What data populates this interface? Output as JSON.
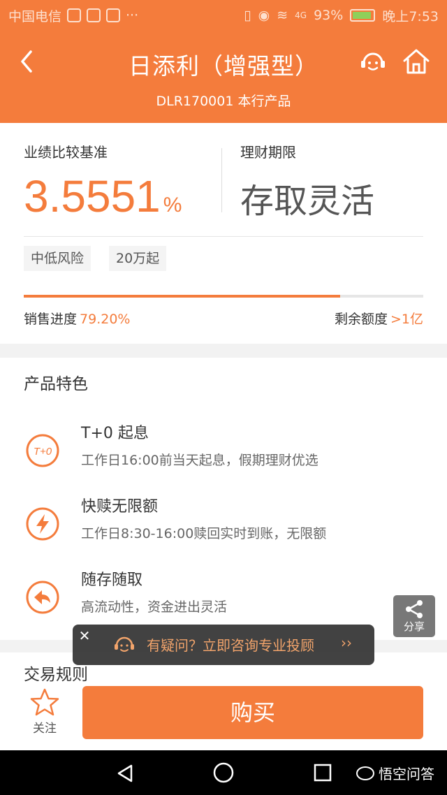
{
  "status_bar": {
    "carrier": "中国电信",
    "battery": "93%",
    "time": "晚上7:53",
    "signal": "4G"
  },
  "header": {
    "title": "日添利（增强型）",
    "subtitle": "DLR170001 本行产品"
  },
  "product": {
    "rate_label": "业绩比较基准",
    "rate_value": "3.5551",
    "rate_unit": "%",
    "term_label": "理财期限",
    "term_value": "存取灵活",
    "tags": [
      "中低风险",
      "20万起"
    ],
    "progress_fraction": 0.792,
    "sales_label": "销售进度",
    "sales_value": "79.20%",
    "remaining_label": "剩余额度",
    "remaining_value": ">1亿"
  },
  "features": {
    "title": "产品特色",
    "items": [
      {
        "icon": "t0-icon",
        "title": "T+0 起息",
        "desc": "工作日16:00前当天起息，假期理财优选"
      },
      {
        "icon": "lightning-icon",
        "title": "快赎无限额",
        "desc": "工作日8:30-16:00赎回实时到账，无限额"
      },
      {
        "icon": "return-arrow-icon",
        "title": "随存随取",
        "desc": "高流动性，资金进出灵活"
      }
    ]
  },
  "rules": {
    "title": "交易规则"
  },
  "share": {
    "label": "分享"
  },
  "toast": {
    "text": "有疑问？立即咨询专业投顾",
    "arrow": "››"
  },
  "bottom": {
    "favorite_label": "关注",
    "buy_label": "购买"
  },
  "watermark": "悟空问答",
  "colors": {
    "brand_orange": "#f47c3c",
    "toast_text": "#f2a46b"
  }
}
